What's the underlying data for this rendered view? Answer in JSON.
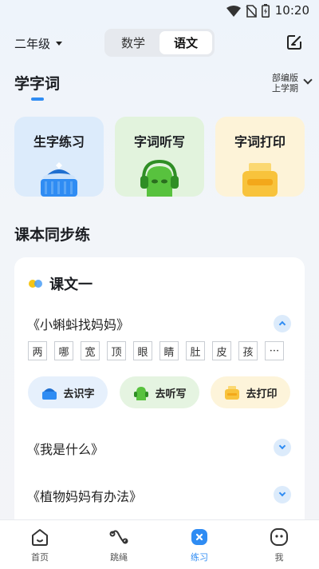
{
  "status_bar": {
    "time": "10:20"
  },
  "header": {
    "grade": "二年级",
    "subjects": [
      {
        "label": "数学",
        "active": false
      },
      {
        "label": "语文",
        "active": true
      }
    ]
  },
  "learn_section": {
    "title": "学字词",
    "edition_line1": "部编版",
    "edition_line2": "上学期",
    "cards": [
      {
        "label": "生字练习",
        "icon": "pencil-sharpener-icon"
      },
      {
        "label": "字词听写",
        "icon": "headphone-character-icon"
      },
      {
        "label": "字词打印",
        "icon": "printer-icon"
      }
    ]
  },
  "textbook_section": {
    "title": "课本同步练",
    "unit_title": "课文一",
    "lessons": [
      {
        "title": "《小蝌蚪找妈妈》",
        "expanded": true,
        "characters": [
          "两",
          "哪",
          "宽",
          "顶",
          "眼",
          "睛",
          "肚",
          "皮",
          "孩",
          "···"
        ],
        "actions": [
          {
            "label": "去识字",
            "icon": "pencil-sharpener-icon"
          },
          {
            "label": "去听写",
            "icon": "headphone-character-icon"
          },
          {
            "label": "去打印",
            "icon": "printer-icon"
          }
        ]
      },
      {
        "title": "《我是什么》",
        "expanded": false
      },
      {
        "title": "《植物妈妈有办法》",
        "expanded": false
      }
    ]
  },
  "bottom_nav": [
    {
      "label": "首页",
      "icon": "home-icon",
      "active": false
    },
    {
      "label": "跳绳",
      "icon": "jump-rope-icon",
      "active": false
    },
    {
      "label": "练习",
      "icon": "practice-icon",
      "active": true
    },
    {
      "label": "我",
      "icon": "profile-face-icon",
      "active": false
    }
  ],
  "colors": {
    "accent": "#2f8cf3",
    "card_blue": "#dcebfb",
    "card_green": "#e2f3dd",
    "card_yellow": "#fdf3d8"
  }
}
